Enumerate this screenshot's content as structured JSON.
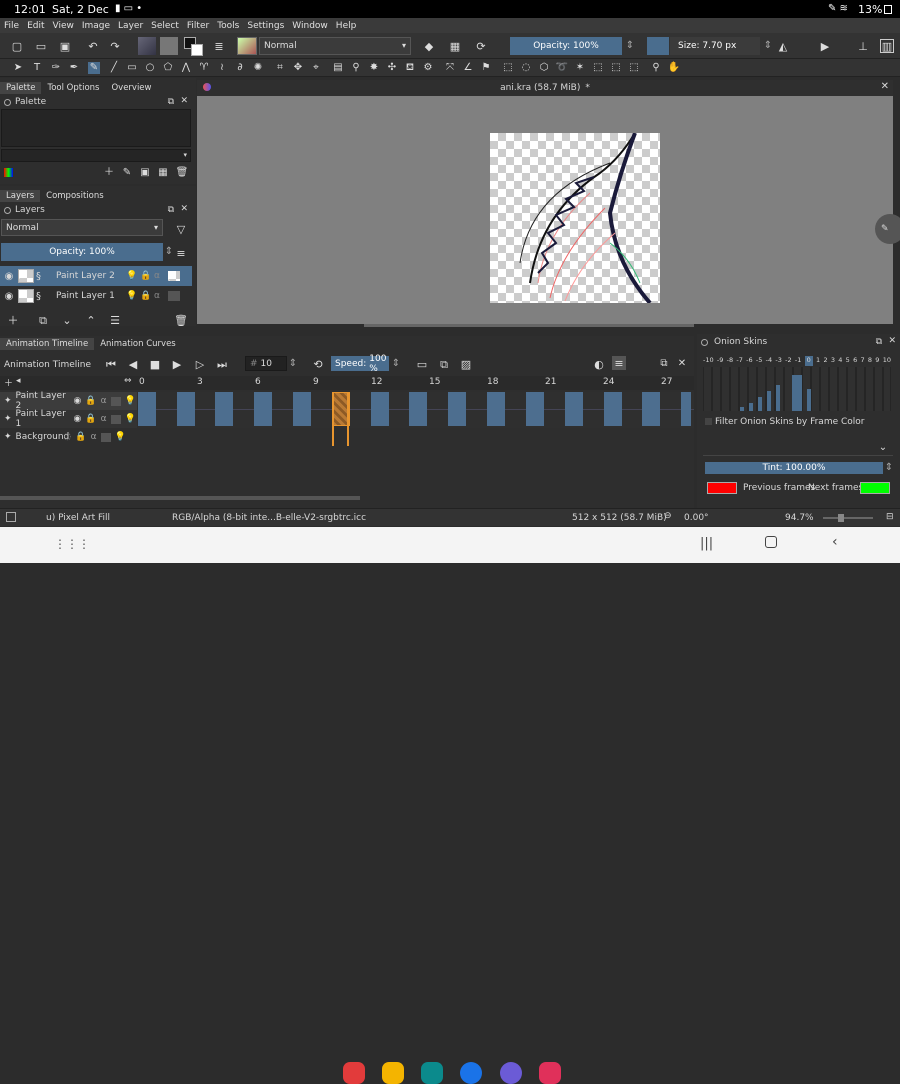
{
  "status": {
    "time": "12:01",
    "date": "Sat, 2 Dec",
    "battery": "13%"
  },
  "menu": [
    "File",
    "Edit",
    "View",
    "Image",
    "Layer",
    "Select",
    "Filter",
    "Tools",
    "Settings",
    "Window",
    "Help"
  ],
  "toolbar": {
    "blend_mode": "Normal",
    "opacity": "Opacity: 100%",
    "size": "Size: 7.70 px"
  },
  "palette_docker": {
    "tabs": [
      "Palette",
      "Tool Options",
      "Overview"
    ],
    "title": "Palette"
  },
  "layers_docker": {
    "tabs": [
      "Layers",
      "Compositions"
    ],
    "title": "Layers",
    "blend_mode": "Normal",
    "opacity": "Opacity:  100%",
    "layers": [
      {
        "name": "Paint Layer 2"
      },
      {
        "name": "Paint Layer 1"
      }
    ]
  },
  "document": {
    "title": "ani.kra (58.7 MiB)",
    "modified": "*"
  },
  "timeline": {
    "tabs": [
      "Animation Timeline",
      "Animation Curves"
    ],
    "title": "Animation Timeline",
    "current_frame": "10",
    "speed_label": "Speed:",
    "speed": "100 %",
    "ruler": [
      "0",
      "3",
      "6",
      "9",
      "12",
      "15",
      "18",
      "21",
      "24",
      "27"
    ],
    "layers": [
      "Paint Layer 2",
      "Paint Layer 1",
      "Background"
    ]
  },
  "onion_skins": {
    "title": "Onion Skins",
    "numbers": [
      "-10",
      "-9",
      "-8",
      "-7",
      "-6",
      "-5",
      "-4",
      "-3",
      "-2",
      "-1",
      "0",
      "1",
      "2",
      "3",
      "4",
      "5",
      "6",
      "7",
      "8",
      "9",
      "10"
    ],
    "filter_label": "Filter Onion Skins by Frame Color",
    "tint": "Tint: 100.00%",
    "previous_label": "Previous frames",
    "next_label": "Next frames",
    "previous_color": "#ff0000",
    "next_color": "#00ff00"
  },
  "statusline": {
    "brush": "u) Pixel Art Fill",
    "color_model": "RGB/Alpha (8-bit inte...B-elle-V2-srgbtrc.icc",
    "size": "512 x 512 (58.7 MiB)",
    "rotation": "0.00°",
    "zoom": "94.7%"
  },
  "accent": "#4a6d8e",
  "highlight_frame_color": "#e8952e"
}
